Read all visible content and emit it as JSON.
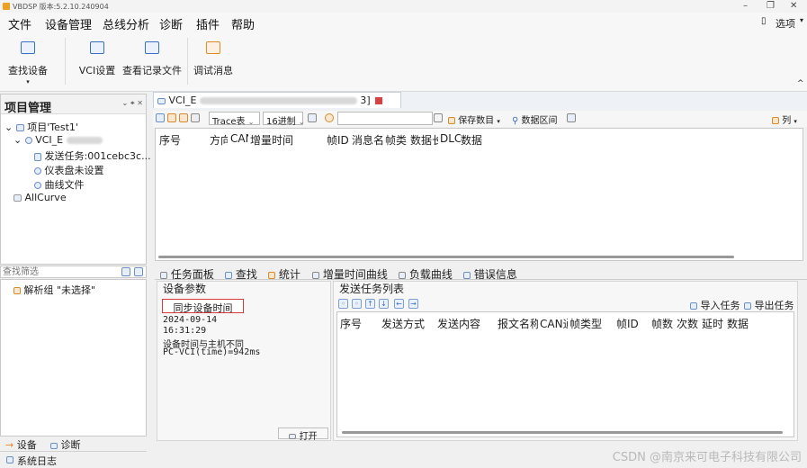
{
  "titlebar": {
    "title": "VBDSP 版本:5.2.10.240904"
  },
  "menu": [
    "文件",
    "设备管理",
    "总线分析",
    "诊断",
    "插件",
    "帮助"
  ],
  "menu_active": "设备管理",
  "options_label": "选项",
  "ribbon": {
    "find_device": "查找设备",
    "vci_settings": "VCI设置",
    "view_records": "查看记录文件",
    "debug_messages": "调试消息"
  },
  "left_panel": {
    "title": "项目管理",
    "tree": {
      "project": "项目'Test1'",
      "vci": "VCI_E",
      "send_task": "发送任务:001cebc3c...",
      "dashboard": "仪表盘未设置",
      "curve_file": "曲线文件",
      "allcurve": "AllCurve"
    },
    "filter_placeholder": "查找筛选",
    "parse_group": "解析组 \"未选择\"",
    "tabs": {
      "device": "设备",
      "diagnose": "诊断"
    },
    "syslog": "系统日志"
  },
  "doc_tab": {
    "prefix": "VCI_E",
    "suffix": "3]"
  },
  "trace_toolbar": {
    "mode": "Trace表",
    "radix": "16进制",
    "save_data": "保存数目",
    "data_range": "数据区间",
    "columns": "列"
  },
  "trace_columns": [
    "序号",
    "方向",
    "CAN",
    "增量时间",
    "帧ID",
    "消息名",
    "帧类",
    "数据长",
    "DLC",
    "数据"
  ],
  "bottom_tabs": [
    "任务面板",
    "查找",
    "统计",
    "增量时间曲线",
    "负载曲线",
    "错误信息"
  ],
  "device_params": {
    "title": "设备参数",
    "sync_button": "同步设备时间",
    "date": "2024-09-14",
    "time": "16:31:29",
    "note": "设备时间与主机不同",
    "diff": "PC-VCI(time)=942ms",
    "open_button": "打开"
  },
  "task_list": {
    "title": "发送任务列表",
    "import": "导入任务",
    "export": "导出任务",
    "columns": [
      "序号",
      "发送方式",
      "发送内容",
      "报文名称",
      "CAN通",
      "帧类型",
      "帧ID",
      "帧数",
      "次数",
      "延时",
      "数据"
    ]
  },
  "watermark": "CSDN @南京来可电子科技有限公司"
}
